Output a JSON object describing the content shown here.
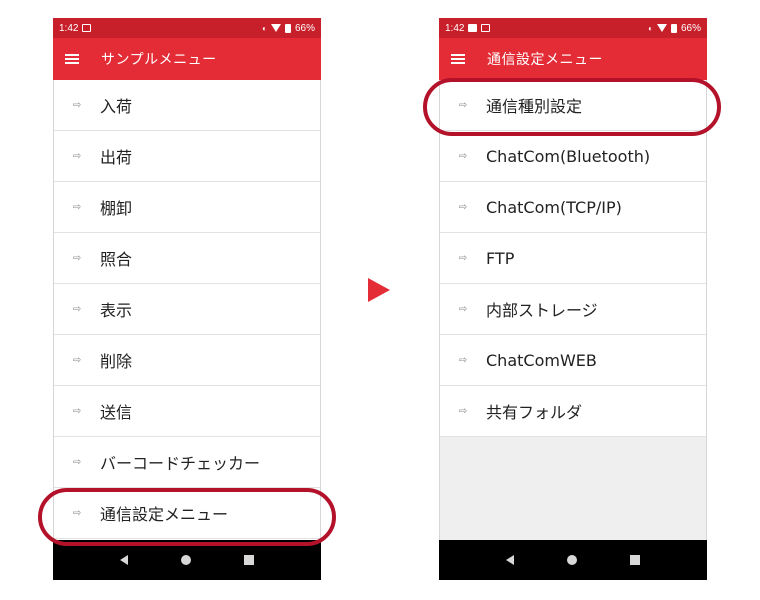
{
  "left_screen": {
    "status": {
      "time": "1:42",
      "battery": "66%"
    },
    "title": "サンプルメニュー",
    "items": [
      {
        "label": "入荷"
      },
      {
        "label": "出荷"
      },
      {
        "label": "棚卸"
      },
      {
        "label": "照合"
      },
      {
        "label": "表示"
      },
      {
        "label": "削除"
      },
      {
        "label": "送信"
      },
      {
        "label": "バーコードチェッカー"
      },
      {
        "label": "通信設定メニュー"
      }
    ],
    "highlighted_item": "通信設定メニュー"
  },
  "right_screen": {
    "status": {
      "time": "1:42",
      "battery": "66%"
    },
    "title": "通信設定メニュー",
    "items": [
      {
        "label": "通信種別設定"
      },
      {
        "label": "ChatCom(Bluetooth)"
      },
      {
        "label": "ChatCom(TCP/IP)"
      },
      {
        "label": "FTP"
      },
      {
        "label": "内部ストレージ"
      },
      {
        "label": "ChatComWEB"
      },
      {
        "label": "共有フォルダ"
      }
    ],
    "highlighted_item": "通信種別設定"
  },
  "colors": {
    "accent": "#e42c36",
    "statusbar": "#c8202b",
    "highlight_ring": "#b3122a"
  },
  "icons": [
    "menu-icon",
    "arrow-icon",
    "nav-back-icon",
    "nav-home-icon",
    "nav-recents-icon",
    "flow-pointer-icon"
  ]
}
